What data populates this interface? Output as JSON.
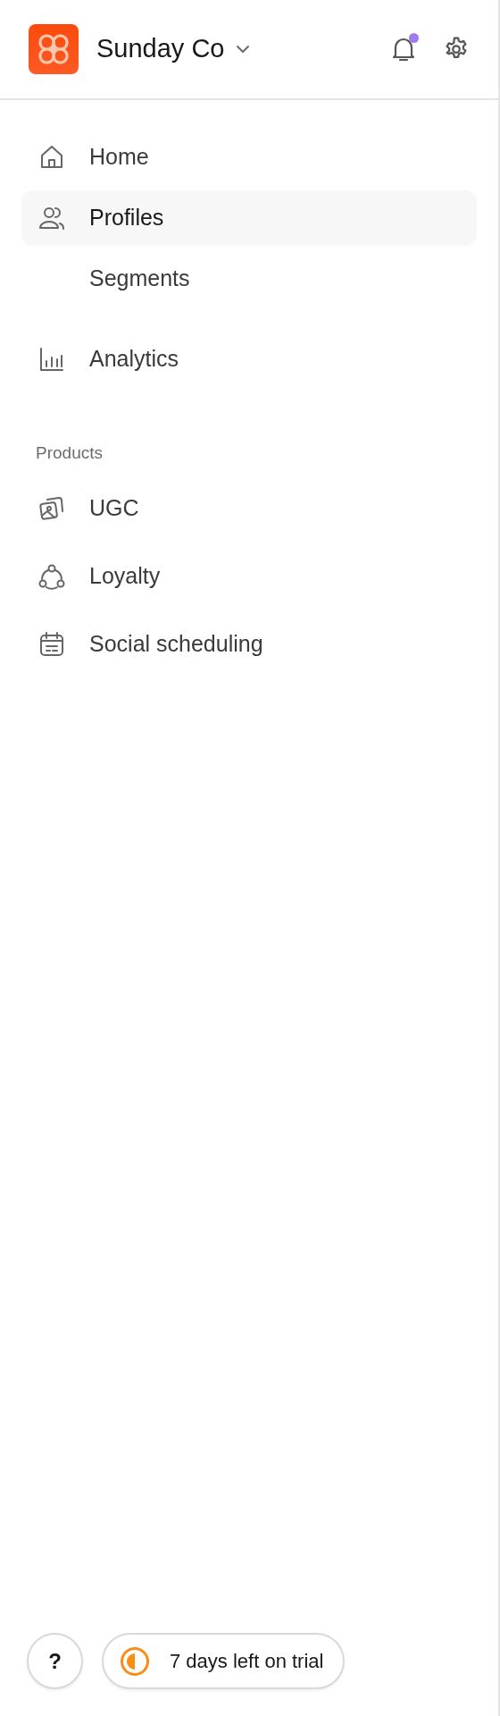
{
  "workspace": {
    "name": "Sunday Co",
    "notification_unread": true
  },
  "nav": [
    {
      "label": "Home",
      "kind": "main",
      "selected": false
    },
    {
      "label": "Profiles",
      "kind": "main",
      "selected": true
    },
    {
      "label": "Segments",
      "kind": "sub",
      "selected": false
    },
    {
      "label": "Analytics",
      "kind": "main",
      "selected": false
    }
  ],
  "sections": [
    {
      "heading": "Products",
      "items": [
        {
          "label": "UGC",
          "selected": false
        },
        {
          "label": "Loyalty",
          "selected": false
        },
        {
          "label": "Social scheduling",
          "selected": false
        }
      ]
    }
  ],
  "footer": {
    "help": "?",
    "trial": "7 days left on trial"
  }
}
